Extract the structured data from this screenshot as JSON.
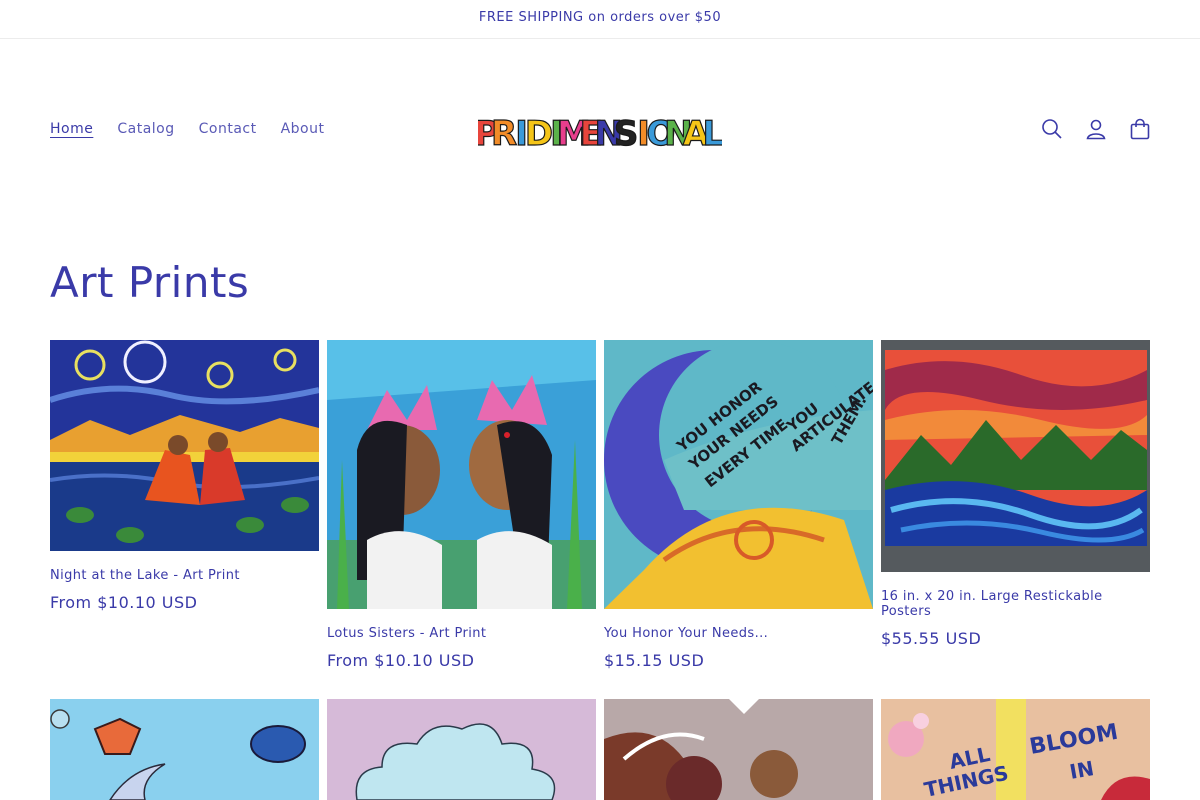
{
  "announcement": "FREE SHIPPING on orders over $50",
  "brand": {
    "name": "PRIDIMENSIONAL",
    "letters": [
      "P",
      "R",
      "I",
      "D",
      "I",
      "M",
      "E",
      "N",
      "S",
      "I",
      "O",
      "N",
      "A",
      "L"
    ],
    "letter_colors": [
      "#e8453c",
      "#f28c28",
      "#3a9ad9",
      "#f5c518",
      "#5bb24a",
      "#e83e8c",
      "#e8453c",
      "#3a3aa8",
      "#222222",
      "#f28c28",
      "#3a9ad9",
      "#5bb24a",
      "#f5c518",
      "#3a9ad9"
    ]
  },
  "nav": {
    "items": [
      {
        "label": "Home",
        "active": true
      },
      {
        "label": "Catalog",
        "active": false
      },
      {
        "label": "Contact",
        "active": false
      },
      {
        "label": "About",
        "active": false
      }
    ]
  },
  "header_icons": [
    "search-icon",
    "account-icon",
    "cart-icon"
  ],
  "collection": {
    "title": "Art Prints",
    "products": [
      {
        "title": "Night at the Lake - Art Print",
        "price": "From $10.10 USD"
      },
      {
        "title": "Lotus Sisters - Art Print",
        "price": "From $10.10 USD"
      },
      {
        "title": "You Honor Your Needs...",
        "price": "$15.15 USD"
      },
      {
        "title": "16 in. x 20 in. Large Restickable Posters",
        "price": "$55.55 USD"
      },
      {
        "title": "",
        "price": ""
      },
      {
        "title": "",
        "price": ""
      },
      {
        "title": "",
        "price": ""
      },
      {
        "title": "",
        "price": ""
      }
    ],
    "artwork_text": {
      "honor": [
        "YOU HONOR",
        "YOUR NEEDS",
        "EVERY TIME",
        "YOU",
        "ARTICULATE",
        "THEM."
      ],
      "bloom": [
        "ALL",
        "THINGS",
        "BLOOM",
        "IN"
      ]
    }
  },
  "colors": {
    "accent": "#3a3aa8",
    "border": "#ececec"
  }
}
